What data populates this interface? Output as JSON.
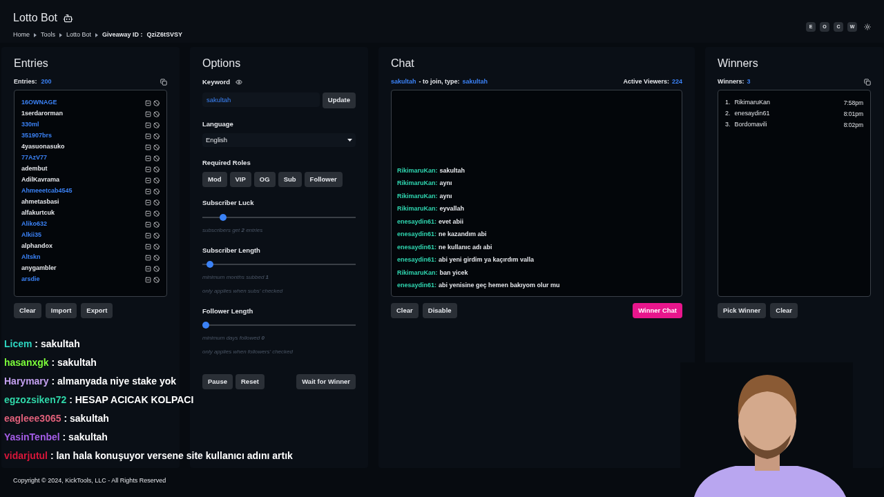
{
  "header": {
    "title": "Lotto Bot",
    "breadcrumbs": [
      "Home",
      "Tools",
      "Lotto Bot"
    ],
    "giveaway_label": "Giveaway ID :",
    "giveaway_id": "QziZ6tSVSY",
    "toolbar": [
      "E",
      "O",
      "C",
      "W"
    ]
  },
  "entries": {
    "title": "Entries",
    "count_label": "Entries:",
    "count": "200",
    "items": [
      {
        "name": "16OWNAGE",
        "subscriber": true
      },
      {
        "name": "1serdarorman",
        "subscriber": false
      },
      {
        "name": "330ml",
        "subscriber": true
      },
      {
        "name": "351907brs",
        "subscriber": true
      },
      {
        "name": "4yasuonasuko",
        "subscriber": false
      },
      {
        "name": "77AzV77",
        "subscriber": true
      },
      {
        "name": "adembut",
        "subscriber": false
      },
      {
        "name": "AdilKavrama",
        "subscriber": false
      },
      {
        "name": "Ahmeeetcab4545",
        "subscriber": true
      },
      {
        "name": "ahmetasbasi",
        "subscriber": false
      },
      {
        "name": "alfakurtcuk",
        "subscriber": false
      },
      {
        "name": "Aliko632",
        "subscriber": true
      },
      {
        "name": "Alkii35",
        "subscriber": true
      },
      {
        "name": "alphandox",
        "subscriber": false
      },
      {
        "name": "Altskn",
        "subscriber": true
      },
      {
        "name": "anygambler",
        "subscriber": false
      },
      {
        "name": "arsdie",
        "subscriber": true
      }
    ],
    "buttons": [
      "Clear",
      "Import",
      "Export"
    ]
  },
  "options": {
    "title": "Options",
    "keyword_label": "Keyword",
    "keyword": "sakultah",
    "update": "Update",
    "language_label": "Language",
    "language": "English",
    "roles_label": "Required Roles",
    "roles": [
      "Mod",
      "VIP",
      "OG",
      "Sub",
      "Follower"
    ],
    "sliders": [
      {
        "label": "Subscriber Luck",
        "level": 0.12,
        "notes": [
          "subscribers get **2** entries"
        ]
      },
      {
        "label": "Subscriber Length",
        "level": 0.03,
        "notes": [
          "minimum months subbed **1**",
          "only applies when subs' checked"
        ]
      },
      {
        "label": "Follower Length",
        "level": 0,
        "notes": [
          "minimum days followed **0**",
          "only applies when followers' checked"
        ]
      }
    ],
    "buttons": [
      "Pause",
      "Reset"
    ],
    "wait_button": "Wait for Winner"
  },
  "chat": {
    "title": "Chat",
    "keyword": "sakultah",
    "join_text": "- to join, type:",
    "join_keyword": "sakultah",
    "viewers_label": "Active Viewers:",
    "viewers": "224",
    "messages": [
      {
        "user": "RikimaruKan:",
        "text": "sakultah"
      },
      {
        "user": "RikimaruKan:",
        "text": "aynı"
      },
      {
        "user": "RikimaruKan:",
        "text": "aynı"
      },
      {
        "user": "RikimaruKan:",
        "text": "eyvallah"
      },
      {
        "user": "enesaydin61:",
        "text": "evet abii"
      },
      {
        "user": "enesaydin61:",
        "text": "ne kazandım abi"
      },
      {
        "user": "enesaydin61:",
        "text": "ne kullanıc adı abi"
      },
      {
        "user": "enesaydin61:",
        "text": "abi yeni girdim ya kaçırdım valla"
      },
      {
        "user": "RikimaruKan:",
        "text": "ban yicek"
      },
      {
        "user": "enesaydin61:",
        "text": "abi yenisine geç hemen bakıyom olur mu"
      }
    ],
    "buttons": [
      "Clear",
      "Disable"
    ],
    "winner_chat": "Winner Chat"
  },
  "winners": {
    "title": "Winners",
    "count_label": "Winners:",
    "count": "3",
    "items": [
      {
        "rank": "1.",
        "name": "RikimaruKan",
        "time": "7:58pm"
      },
      {
        "rank": "2.",
        "name": "enesaydin61",
        "time": "8:01pm"
      },
      {
        "rank": "3.",
        "name": "Bordomavili",
        "time": "8:02pm"
      }
    ],
    "buttons": [
      "Pick Winner",
      "Clear"
    ]
  },
  "footer": "Copyright © 2024, KickTools, LLC - All Rights Reserved",
  "stream_chat": [
    {
      "user": "Licem",
      "color": "#2dd4bf",
      "text": ": sakultah"
    },
    {
      "user": "hasanxgk",
      "color": "#7cfc3a",
      "text": ": sakultah"
    },
    {
      "user": "Harymary",
      "color": "#c4a0f0",
      "text": ": almanyada niye stake yok"
    },
    {
      "user": "egzozsiken72",
      "color": "#2fd6a8",
      "text": ": HESAP ACICAK KOLPACI"
    },
    {
      "user": "eagleee3065",
      "color": "#e0607a",
      "text": ": sakultah"
    },
    {
      "user": "YasinTenbel",
      "color": "#a55de8",
      "text": ": sakultah"
    },
    {
      "user": "vidarjutul",
      "color": "#d9163a",
      "text": ": lan hala konuşuyor versene site kullanıcı adını artık"
    }
  ]
}
